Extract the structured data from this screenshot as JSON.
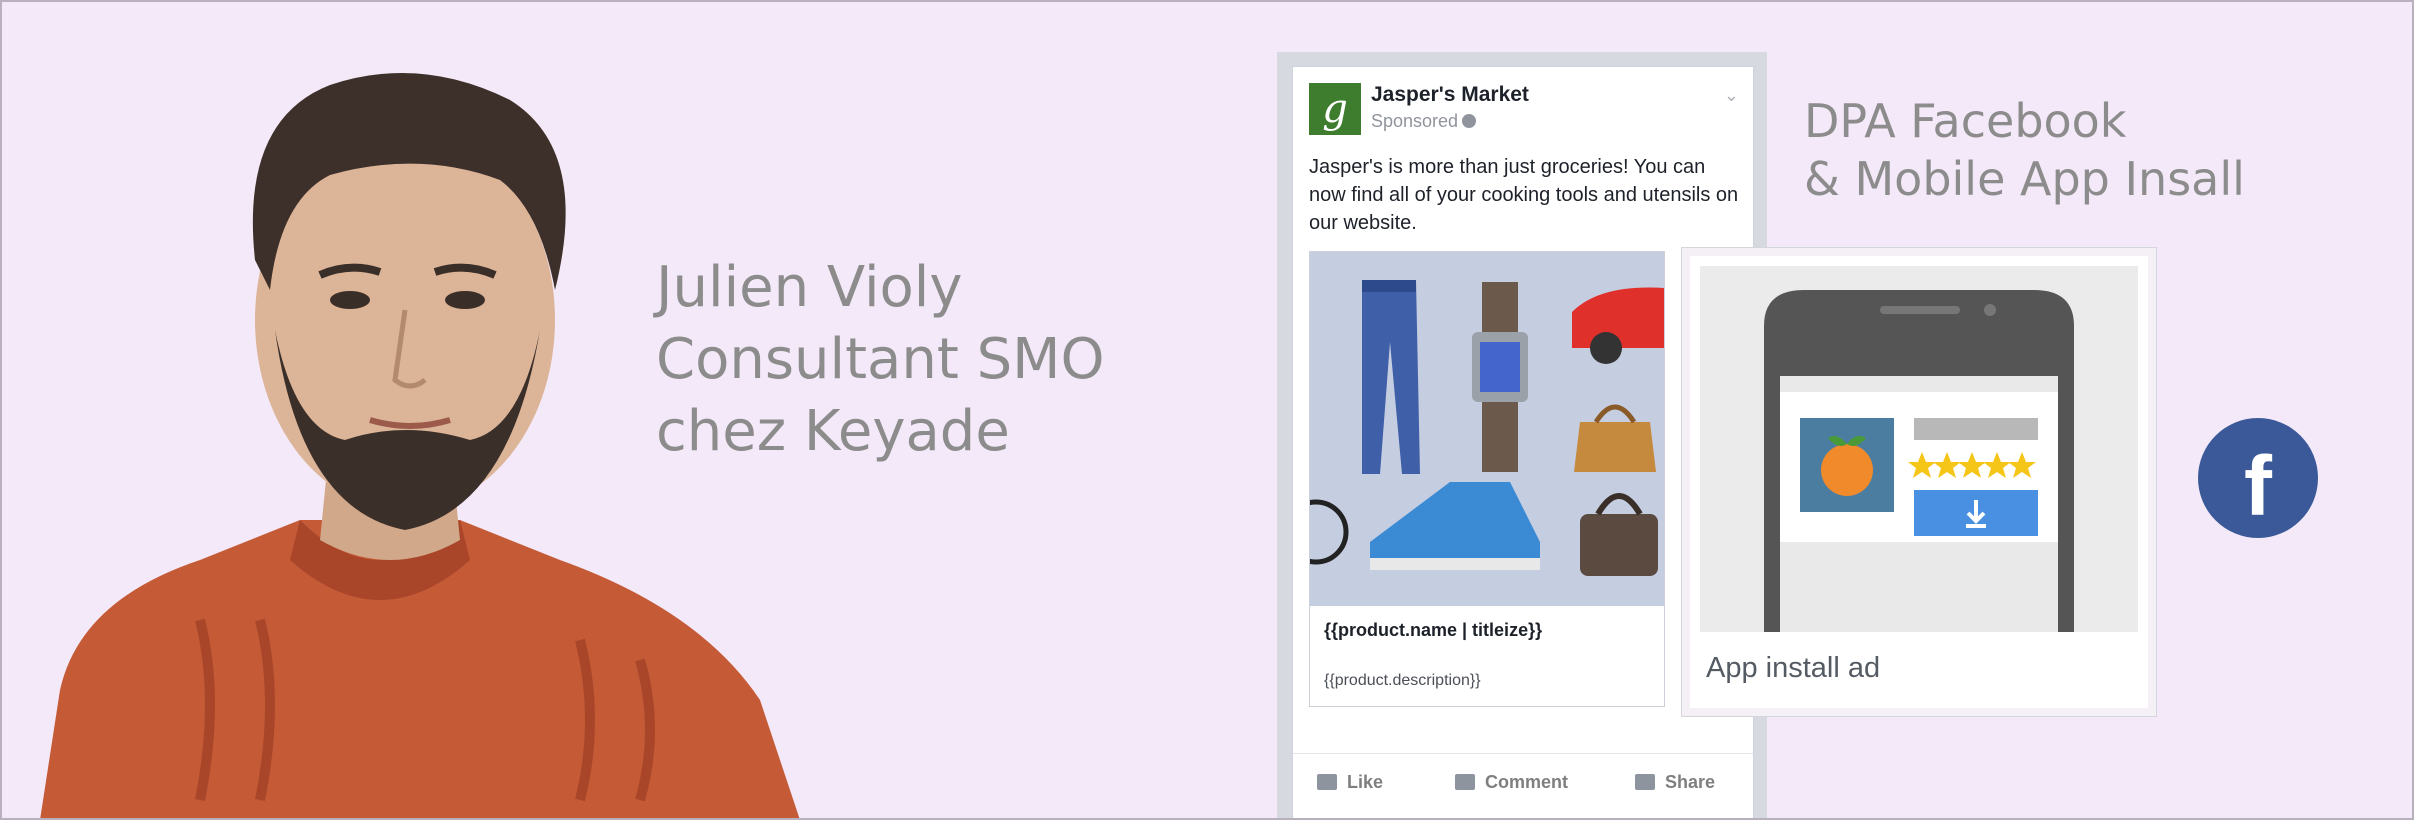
{
  "speaker": {
    "name": "Julien Violy",
    "role": "Consultant SMO",
    "company": "chez Keyade"
  },
  "headline": {
    "line1": "DPA Facebook",
    "line2": "& Mobile App Insall"
  },
  "post": {
    "logo_letter": "g",
    "page_name": "Jasper's Market",
    "sponsored": "Sponsored",
    "body_text": "Jasper's is more than just groceries! You can now find all of your cooking tools and utensils on our website.",
    "card_title": "{{product.name | titleize}}",
    "card_description": "{{product.description}}",
    "actions": {
      "like": "Like",
      "comment": "Comment",
      "share": "Share"
    }
  },
  "app_ad": {
    "caption": "App install ad",
    "rating_stars": 5
  },
  "facebook_icon": {
    "glyph": "f"
  },
  "colors": {
    "background": "#f4e9f8",
    "facebook_blue": "#3b5998",
    "sweater": "#c45a36",
    "text_gray": "#8c8c8c",
    "install_button": "#4a90e2",
    "stars": "#f5c518"
  }
}
